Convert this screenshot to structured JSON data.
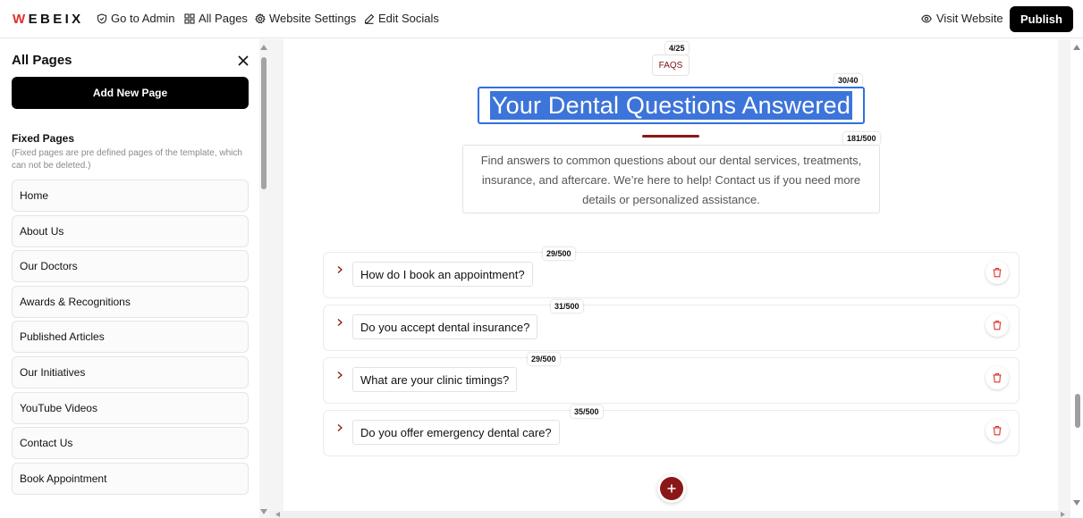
{
  "topbar": {
    "logo_rest": "EBEIX",
    "logo_w": "W",
    "nav": [
      {
        "label": "Go to Admin",
        "icon": "shield-check-icon"
      },
      {
        "label": "All Pages",
        "icon": "grid-icon"
      },
      {
        "label": "Website Settings",
        "icon": "gear-icon"
      },
      {
        "label": "Edit Socials",
        "icon": "pencil-icon"
      }
    ],
    "visit_label": "Visit Website",
    "publish_label": "Publish"
  },
  "sidebar": {
    "title": "All Pages",
    "add_label": "Add New Page",
    "fixed_title": "Fixed Pages",
    "fixed_note": "(Fixed pages are pre defined pages of the template, which can not be deleted.)",
    "pages": [
      "Home",
      "About Us",
      "Our Doctors",
      "Awards & Recognitions",
      "Published Articles",
      "Our Initiatives",
      "YouTube Videos",
      "Contact Us",
      "Book Appointment"
    ]
  },
  "editor": {
    "tag_counter": "4/25",
    "tag": "FAQS",
    "headline_counter": "30/40",
    "headline": "Your Dental Questions Answered",
    "desc_counter": "181/500",
    "description": "Find answers to common questions about our dental services, treatments, insurance, and aftercare. We’re here to help! Contact us if you need more details or personalized assistance.",
    "faqs": [
      {
        "counter": "29/500",
        "question": "How do I book an appointment?"
      },
      {
        "counter": "31/500",
        "question": "Do you accept dental insurance?"
      },
      {
        "counter": "29/500",
        "question": "What are your clinic timings?"
      },
      {
        "counter": "35/500",
        "question": "Do you offer emergency dental care?"
      }
    ]
  },
  "colors": {
    "accent": "#8b1717",
    "selection": "#3d74d9",
    "logo_w": "#e0322a"
  }
}
